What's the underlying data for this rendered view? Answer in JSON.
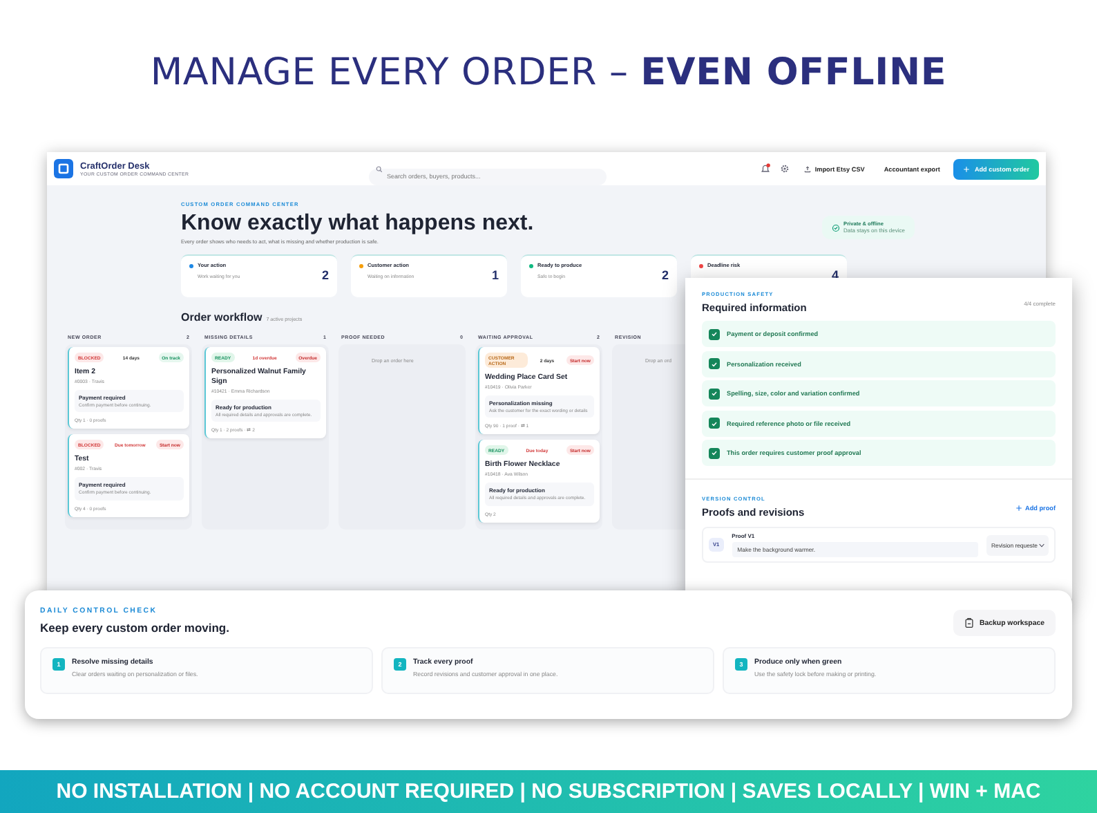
{
  "headline": "MANAGE EVERY ORDER – **EVEN OFFLINE**",
  "app": {
    "brand": "CraftOrder Desk",
    "tagline": "YOUR CUSTOM ORDER COMMAND CENTER",
    "search": {
      "placeholder": "Search orders, buyers, products..."
    },
    "header_buttons": [
      {
        "label": "Import Etsy CSV",
        "kind": "import"
      },
      {
        "label": "Accountant export",
        "kind": "plain"
      },
      {
        "label": "Add custom order",
        "kind": "primary"
      }
    ],
    "hero": {
      "eyebrow": "CUSTOM ORDER COMMAND CENTER",
      "title": "Know exactly what happens next.",
      "subtitle": "Every order shows who needs to act, what is missing and whether production is safe.",
      "privacy": {
        "title": "Private & offline",
        "note": "Data stays on this device"
      }
    },
    "stats": [
      {
        "label": "Your action",
        "note": "Work waiting for you",
        "value": "2",
        "color": "#1e88e5"
      },
      {
        "label": "Customer action",
        "note": "Waiting on information",
        "value": "1",
        "color": "#f59e0b"
      },
      {
        "label": "Ready to produce",
        "note": "Safe to begin",
        "value": "2",
        "color": "#10b981"
      },
      {
        "label": "Deadline risk",
        "value": "4",
        "color": "#ef4444"
      }
    ],
    "workflow": {
      "title": "Order workflow",
      "count": "7 active projects",
      "columns": [
        {
          "name": "NEW ORDER",
          "count": "2",
          "cards": [
            {
              "tags": [
                {
                  "text": "BLOCKED",
                  "kind": "blocked"
                },
                {
                  "text": "14 days",
                  "kind": "info"
                },
                {
                  "text": "On track",
                  "kind": "ok"
                }
              ],
              "title": "Item 2",
              "meta": "#0003 · Travis",
              "note_title": "Payment required",
              "note": "Confirm payment before continuing.",
              "footer": "Qty 1 · 0 proofs"
            },
            {
              "tags": [
                {
                  "text": "BLOCKED",
                  "kind": "blocked"
                },
                {
                  "text": "Due tomorrow",
                  "kind": "warn"
                },
                {
                  "text": "Start now",
                  "kind": "alert"
                }
              ],
              "title": "Test",
              "meta": "#002 · Travis",
              "note_title": "Payment required",
              "note": "Confirm payment before continuing.",
              "footer": "Qty 4 · 0 proofs"
            }
          ]
        },
        {
          "name": "MISSING DETAILS",
          "count": "1",
          "cards": [
            {
              "tags": [
                {
                  "text": "READY",
                  "kind": "ready"
                },
                {
                  "text": "1d overdue",
                  "kind": "warn"
                },
                {
                  "text": "Overdue",
                  "kind": "alert"
                }
              ],
              "title": "Personalized Walnut Family Sign",
              "meta": "#10421 · Emma Richardson",
              "note_title": "Ready for production",
              "note": "All required details and approvals are complete.",
              "footer": "Qty 1 · 2 proofs · ⇄ 2"
            }
          ]
        },
        {
          "name": "PROOF NEEDED",
          "count": "0",
          "empty": "Drop an order here"
        },
        {
          "name": "WAITING APPROVAL",
          "count": "2",
          "cards": [
            {
              "tags": [
                {
                  "text": "CUSTOMER ACTION",
                  "kind": "action"
                },
                {
                  "text": "2 days",
                  "kind": "info"
                },
                {
                  "text": "Start now",
                  "kind": "alert"
                }
              ],
              "title": "Wedding Place Card Set",
              "meta": "#10419 · Olivia Parker",
              "note_title": "Personalization missing",
              "note": "Ask the customer for the exact wording or details",
              "footer": "Qty 90 · 1 proof · ⇄ 1"
            },
            {
              "tags": [
                {
                  "text": "READY",
                  "kind": "ready"
                },
                {
                  "text": "Due today",
                  "kind": "warn"
                },
                {
                  "text": "Start now",
                  "kind": "alert"
                }
              ],
              "title": "Birth Flower Necklace",
              "meta": "#10418 · Ava Wilson",
              "note_title": "Ready for production",
              "note": "All required details and approvals are complete.",
              "footer": "Qty 2"
            }
          ]
        },
        {
          "name": "REVISION",
          "empty": "Drop an ord"
        }
      ]
    }
  },
  "safety": {
    "eyebrow": "PRODUCTION SAFETY",
    "title": "Required information",
    "progress": "4/4 complete",
    "checks": [
      {
        "label": "Payment or deposit confirmed",
        "checked": true
      },
      {
        "label": "Personalization received",
        "checked": true
      },
      {
        "label": "Spelling, size, color and variation confirmed",
        "checked": true
      },
      {
        "label": "Required reference photo or file received",
        "checked": true
      },
      {
        "label": "This order requires customer proof approval",
        "checked": true
      }
    ],
    "versions": {
      "eyebrow": "VERSION CONTROL",
      "title": "Proofs and revisions",
      "action": "Add proof",
      "proofs": [
        {
          "badge": "V1",
          "title": "Proof V1",
          "note": "Make the background warmer.",
          "status": "Revision requeste"
        }
      ]
    }
  },
  "daily": {
    "eyebrow": "DAILY CONTROL CHECK",
    "title": "Keep every custom order moving.",
    "button": "Backup workspace",
    "steps": [
      {
        "number": "1",
        "title": "Resolve missing details",
        "note": "Clear orders waiting on personalization or files."
      },
      {
        "number": "2",
        "title": "Track every proof",
        "note": "Record revisions and customer approval in one place."
      },
      {
        "number": "3",
        "title": "Produce only when green",
        "note": "Use the safety lock before making or printing."
      }
    ]
  },
  "banner": "NO INSTALLATION | NO ACCOUNT REQUIRED | NO SUBSCRIPTION | SAVES LOCALLY | WIN + MAC"
}
